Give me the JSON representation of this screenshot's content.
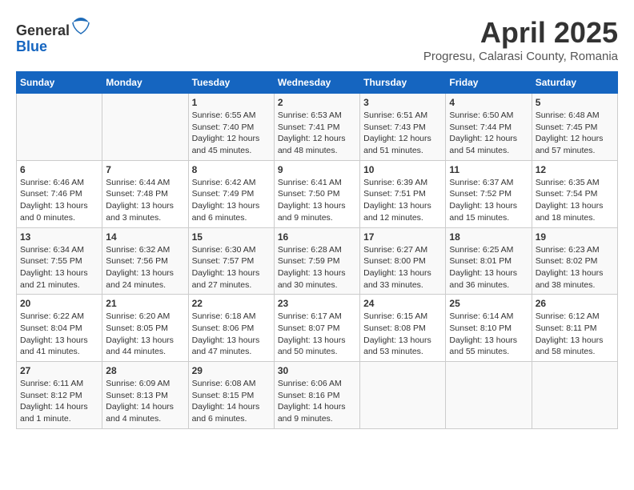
{
  "header": {
    "logo_line1": "General",
    "logo_line2": "Blue",
    "main_title": "April 2025",
    "subtitle": "Progresu, Calarasi County, Romania"
  },
  "days_of_week": [
    "Sunday",
    "Monday",
    "Tuesday",
    "Wednesday",
    "Thursday",
    "Friday",
    "Saturday"
  ],
  "weeks": [
    [
      {
        "day": "",
        "content": ""
      },
      {
        "day": "",
        "content": ""
      },
      {
        "day": "1",
        "content": "Sunrise: 6:55 AM\nSunset: 7:40 PM\nDaylight: 12 hours and 45 minutes."
      },
      {
        "day": "2",
        "content": "Sunrise: 6:53 AM\nSunset: 7:41 PM\nDaylight: 12 hours and 48 minutes."
      },
      {
        "day": "3",
        "content": "Sunrise: 6:51 AM\nSunset: 7:43 PM\nDaylight: 12 hours and 51 minutes."
      },
      {
        "day": "4",
        "content": "Sunrise: 6:50 AM\nSunset: 7:44 PM\nDaylight: 12 hours and 54 minutes."
      },
      {
        "day": "5",
        "content": "Sunrise: 6:48 AM\nSunset: 7:45 PM\nDaylight: 12 hours and 57 minutes."
      }
    ],
    [
      {
        "day": "6",
        "content": "Sunrise: 6:46 AM\nSunset: 7:46 PM\nDaylight: 13 hours and 0 minutes."
      },
      {
        "day": "7",
        "content": "Sunrise: 6:44 AM\nSunset: 7:48 PM\nDaylight: 13 hours and 3 minutes."
      },
      {
        "day": "8",
        "content": "Sunrise: 6:42 AM\nSunset: 7:49 PM\nDaylight: 13 hours and 6 minutes."
      },
      {
        "day": "9",
        "content": "Sunrise: 6:41 AM\nSunset: 7:50 PM\nDaylight: 13 hours and 9 minutes."
      },
      {
        "day": "10",
        "content": "Sunrise: 6:39 AM\nSunset: 7:51 PM\nDaylight: 13 hours and 12 minutes."
      },
      {
        "day": "11",
        "content": "Sunrise: 6:37 AM\nSunset: 7:52 PM\nDaylight: 13 hours and 15 minutes."
      },
      {
        "day": "12",
        "content": "Sunrise: 6:35 AM\nSunset: 7:54 PM\nDaylight: 13 hours and 18 minutes."
      }
    ],
    [
      {
        "day": "13",
        "content": "Sunrise: 6:34 AM\nSunset: 7:55 PM\nDaylight: 13 hours and 21 minutes."
      },
      {
        "day": "14",
        "content": "Sunrise: 6:32 AM\nSunset: 7:56 PM\nDaylight: 13 hours and 24 minutes."
      },
      {
        "day": "15",
        "content": "Sunrise: 6:30 AM\nSunset: 7:57 PM\nDaylight: 13 hours and 27 minutes."
      },
      {
        "day": "16",
        "content": "Sunrise: 6:28 AM\nSunset: 7:59 PM\nDaylight: 13 hours and 30 minutes."
      },
      {
        "day": "17",
        "content": "Sunrise: 6:27 AM\nSunset: 8:00 PM\nDaylight: 13 hours and 33 minutes."
      },
      {
        "day": "18",
        "content": "Sunrise: 6:25 AM\nSunset: 8:01 PM\nDaylight: 13 hours and 36 minutes."
      },
      {
        "day": "19",
        "content": "Sunrise: 6:23 AM\nSunset: 8:02 PM\nDaylight: 13 hours and 38 minutes."
      }
    ],
    [
      {
        "day": "20",
        "content": "Sunrise: 6:22 AM\nSunset: 8:04 PM\nDaylight: 13 hours and 41 minutes."
      },
      {
        "day": "21",
        "content": "Sunrise: 6:20 AM\nSunset: 8:05 PM\nDaylight: 13 hours and 44 minutes."
      },
      {
        "day": "22",
        "content": "Sunrise: 6:18 AM\nSunset: 8:06 PM\nDaylight: 13 hours and 47 minutes."
      },
      {
        "day": "23",
        "content": "Sunrise: 6:17 AM\nSunset: 8:07 PM\nDaylight: 13 hours and 50 minutes."
      },
      {
        "day": "24",
        "content": "Sunrise: 6:15 AM\nSunset: 8:08 PM\nDaylight: 13 hours and 53 minutes."
      },
      {
        "day": "25",
        "content": "Sunrise: 6:14 AM\nSunset: 8:10 PM\nDaylight: 13 hours and 55 minutes."
      },
      {
        "day": "26",
        "content": "Sunrise: 6:12 AM\nSunset: 8:11 PM\nDaylight: 13 hours and 58 minutes."
      }
    ],
    [
      {
        "day": "27",
        "content": "Sunrise: 6:11 AM\nSunset: 8:12 PM\nDaylight: 14 hours and 1 minute."
      },
      {
        "day": "28",
        "content": "Sunrise: 6:09 AM\nSunset: 8:13 PM\nDaylight: 14 hours and 4 minutes."
      },
      {
        "day": "29",
        "content": "Sunrise: 6:08 AM\nSunset: 8:15 PM\nDaylight: 14 hours and 6 minutes."
      },
      {
        "day": "30",
        "content": "Sunrise: 6:06 AM\nSunset: 8:16 PM\nDaylight: 14 hours and 9 minutes."
      },
      {
        "day": "",
        "content": ""
      },
      {
        "day": "",
        "content": ""
      },
      {
        "day": "",
        "content": ""
      }
    ]
  ]
}
